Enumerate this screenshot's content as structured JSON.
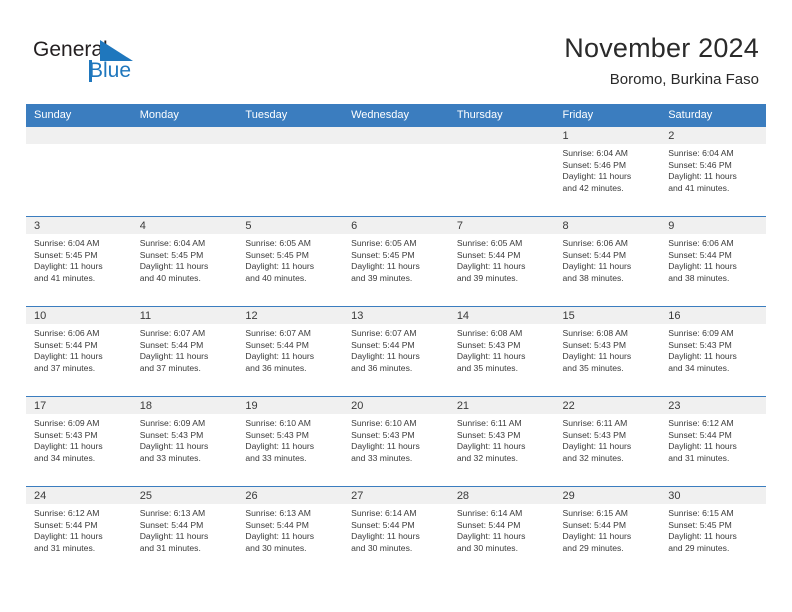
{
  "logo": {
    "text_general": "General",
    "text_blue": "Blue",
    "triangle_icon": "triangle-icon",
    "brand_color": "#1f77bd"
  },
  "header": {
    "title": "November 2024",
    "subtitle": "Boromo, Burkina Faso"
  },
  "calendar": {
    "accent_color": "#3b7dbf",
    "daynum_band_color": "#f0f0f0",
    "weekday_headers": [
      "Sunday",
      "Monday",
      "Tuesday",
      "Wednesday",
      "Thursday",
      "Friday",
      "Saturday"
    ],
    "weeks": [
      [
        {
          "day": "",
          "empty": true,
          "sunrise": "",
          "sunset": "",
          "daylight_l1": "",
          "daylight_l2": ""
        },
        {
          "day": "",
          "empty": true,
          "sunrise": "",
          "sunset": "",
          "daylight_l1": "",
          "daylight_l2": ""
        },
        {
          "day": "",
          "empty": true,
          "sunrise": "",
          "sunset": "",
          "daylight_l1": "",
          "daylight_l2": ""
        },
        {
          "day": "",
          "empty": true,
          "sunrise": "",
          "sunset": "",
          "daylight_l1": "",
          "daylight_l2": ""
        },
        {
          "day": "",
          "empty": true,
          "sunrise": "",
          "sunset": "",
          "daylight_l1": "",
          "daylight_l2": ""
        },
        {
          "day": "1",
          "empty": false,
          "sunrise": "Sunrise: 6:04 AM",
          "sunset": "Sunset: 5:46 PM",
          "daylight_l1": "Daylight: 11 hours",
          "daylight_l2": "and 42 minutes."
        },
        {
          "day": "2",
          "empty": false,
          "sunrise": "Sunrise: 6:04 AM",
          "sunset": "Sunset: 5:46 PM",
          "daylight_l1": "Daylight: 11 hours",
          "daylight_l2": "and 41 minutes."
        }
      ],
      [
        {
          "day": "3",
          "empty": false,
          "sunrise": "Sunrise: 6:04 AM",
          "sunset": "Sunset: 5:45 PM",
          "daylight_l1": "Daylight: 11 hours",
          "daylight_l2": "and 41 minutes."
        },
        {
          "day": "4",
          "empty": false,
          "sunrise": "Sunrise: 6:04 AM",
          "sunset": "Sunset: 5:45 PM",
          "daylight_l1": "Daylight: 11 hours",
          "daylight_l2": "and 40 minutes."
        },
        {
          "day": "5",
          "empty": false,
          "sunrise": "Sunrise: 6:05 AM",
          "sunset": "Sunset: 5:45 PM",
          "daylight_l1": "Daylight: 11 hours",
          "daylight_l2": "and 40 minutes."
        },
        {
          "day": "6",
          "empty": false,
          "sunrise": "Sunrise: 6:05 AM",
          "sunset": "Sunset: 5:45 PM",
          "daylight_l1": "Daylight: 11 hours",
          "daylight_l2": "and 39 minutes."
        },
        {
          "day": "7",
          "empty": false,
          "sunrise": "Sunrise: 6:05 AM",
          "sunset": "Sunset: 5:44 PM",
          "daylight_l1": "Daylight: 11 hours",
          "daylight_l2": "and 39 minutes."
        },
        {
          "day": "8",
          "empty": false,
          "sunrise": "Sunrise: 6:06 AM",
          "sunset": "Sunset: 5:44 PM",
          "daylight_l1": "Daylight: 11 hours",
          "daylight_l2": "and 38 minutes."
        },
        {
          "day": "9",
          "empty": false,
          "sunrise": "Sunrise: 6:06 AM",
          "sunset": "Sunset: 5:44 PM",
          "daylight_l1": "Daylight: 11 hours",
          "daylight_l2": "and 38 minutes."
        }
      ],
      [
        {
          "day": "10",
          "empty": false,
          "sunrise": "Sunrise: 6:06 AM",
          "sunset": "Sunset: 5:44 PM",
          "daylight_l1": "Daylight: 11 hours",
          "daylight_l2": "and 37 minutes."
        },
        {
          "day": "11",
          "empty": false,
          "sunrise": "Sunrise: 6:07 AM",
          "sunset": "Sunset: 5:44 PM",
          "daylight_l1": "Daylight: 11 hours",
          "daylight_l2": "and 37 minutes."
        },
        {
          "day": "12",
          "empty": false,
          "sunrise": "Sunrise: 6:07 AM",
          "sunset": "Sunset: 5:44 PM",
          "daylight_l1": "Daylight: 11 hours",
          "daylight_l2": "and 36 minutes."
        },
        {
          "day": "13",
          "empty": false,
          "sunrise": "Sunrise: 6:07 AM",
          "sunset": "Sunset: 5:44 PM",
          "daylight_l1": "Daylight: 11 hours",
          "daylight_l2": "and 36 minutes."
        },
        {
          "day": "14",
          "empty": false,
          "sunrise": "Sunrise: 6:08 AM",
          "sunset": "Sunset: 5:43 PM",
          "daylight_l1": "Daylight: 11 hours",
          "daylight_l2": "and 35 minutes."
        },
        {
          "day": "15",
          "empty": false,
          "sunrise": "Sunrise: 6:08 AM",
          "sunset": "Sunset: 5:43 PM",
          "daylight_l1": "Daylight: 11 hours",
          "daylight_l2": "and 35 minutes."
        },
        {
          "day": "16",
          "empty": false,
          "sunrise": "Sunrise: 6:09 AM",
          "sunset": "Sunset: 5:43 PM",
          "daylight_l1": "Daylight: 11 hours",
          "daylight_l2": "and 34 minutes."
        }
      ],
      [
        {
          "day": "17",
          "empty": false,
          "sunrise": "Sunrise: 6:09 AM",
          "sunset": "Sunset: 5:43 PM",
          "daylight_l1": "Daylight: 11 hours",
          "daylight_l2": "and 34 minutes."
        },
        {
          "day": "18",
          "empty": false,
          "sunrise": "Sunrise: 6:09 AM",
          "sunset": "Sunset: 5:43 PM",
          "daylight_l1": "Daylight: 11 hours",
          "daylight_l2": "and 33 minutes."
        },
        {
          "day": "19",
          "empty": false,
          "sunrise": "Sunrise: 6:10 AM",
          "sunset": "Sunset: 5:43 PM",
          "daylight_l1": "Daylight: 11 hours",
          "daylight_l2": "and 33 minutes."
        },
        {
          "day": "20",
          "empty": false,
          "sunrise": "Sunrise: 6:10 AM",
          "sunset": "Sunset: 5:43 PM",
          "daylight_l1": "Daylight: 11 hours",
          "daylight_l2": "and 33 minutes."
        },
        {
          "day": "21",
          "empty": false,
          "sunrise": "Sunrise: 6:11 AM",
          "sunset": "Sunset: 5:43 PM",
          "daylight_l1": "Daylight: 11 hours",
          "daylight_l2": "and 32 minutes."
        },
        {
          "day": "22",
          "empty": false,
          "sunrise": "Sunrise: 6:11 AM",
          "sunset": "Sunset: 5:43 PM",
          "daylight_l1": "Daylight: 11 hours",
          "daylight_l2": "and 32 minutes."
        },
        {
          "day": "23",
          "empty": false,
          "sunrise": "Sunrise: 6:12 AM",
          "sunset": "Sunset: 5:44 PM",
          "daylight_l1": "Daylight: 11 hours",
          "daylight_l2": "and 31 minutes."
        }
      ],
      [
        {
          "day": "24",
          "empty": false,
          "sunrise": "Sunrise: 6:12 AM",
          "sunset": "Sunset: 5:44 PM",
          "daylight_l1": "Daylight: 11 hours",
          "daylight_l2": "and 31 minutes."
        },
        {
          "day": "25",
          "empty": false,
          "sunrise": "Sunrise: 6:13 AM",
          "sunset": "Sunset: 5:44 PM",
          "daylight_l1": "Daylight: 11 hours",
          "daylight_l2": "and 31 minutes."
        },
        {
          "day": "26",
          "empty": false,
          "sunrise": "Sunrise: 6:13 AM",
          "sunset": "Sunset: 5:44 PM",
          "daylight_l1": "Daylight: 11 hours",
          "daylight_l2": "and 30 minutes."
        },
        {
          "day": "27",
          "empty": false,
          "sunrise": "Sunrise: 6:14 AM",
          "sunset": "Sunset: 5:44 PM",
          "daylight_l1": "Daylight: 11 hours",
          "daylight_l2": "and 30 minutes."
        },
        {
          "day": "28",
          "empty": false,
          "sunrise": "Sunrise: 6:14 AM",
          "sunset": "Sunset: 5:44 PM",
          "daylight_l1": "Daylight: 11 hours",
          "daylight_l2": "and 30 minutes."
        },
        {
          "day": "29",
          "empty": false,
          "sunrise": "Sunrise: 6:15 AM",
          "sunset": "Sunset: 5:44 PM",
          "daylight_l1": "Daylight: 11 hours",
          "daylight_l2": "and 29 minutes."
        },
        {
          "day": "30",
          "empty": false,
          "sunrise": "Sunrise: 6:15 AM",
          "sunset": "Sunset: 5:45 PM",
          "daylight_l1": "Daylight: 11 hours",
          "daylight_l2": "and 29 minutes."
        }
      ]
    ]
  }
}
